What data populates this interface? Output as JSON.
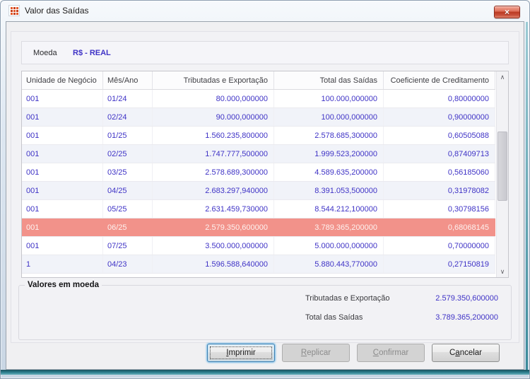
{
  "window": {
    "title": "Valor das Saídas"
  },
  "icons": {
    "close": "×",
    "scroll_up": "∧",
    "scroll_down": "∨"
  },
  "moeda": {
    "label": "Moeda",
    "value": "R$ - REAL"
  },
  "table": {
    "columns": [
      {
        "label": "Unidade de Negócio",
        "align": "left"
      },
      {
        "label": "Mês/Ano",
        "align": "left"
      },
      {
        "label": "Tributadas e Exportação",
        "align": "right"
      },
      {
        "label": "Total das Saídas",
        "align": "right"
      },
      {
        "label": "Coeficiente de Creditamento",
        "align": "right"
      }
    ],
    "selected_index": 7,
    "rows": [
      [
        "001",
        "01/24",
        "80.000,000000",
        "100.000,000000",
        "0,80000000"
      ],
      [
        "001",
        "02/24",
        "90.000,000000",
        "100.000,000000",
        "0,90000000"
      ],
      [
        "001",
        "01/25",
        "1.560.235,800000",
        "2.578.685,300000",
        "0,60505088"
      ],
      [
        "001",
        "02/25",
        "1.747.777,500000",
        "1.999.523,200000",
        "0,87409713"
      ],
      [
        "001",
        "03/25",
        "2.578.689,300000",
        "4.589.635,200000",
        "0,56185060"
      ],
      [
        "001",
        "04/25",
        "2.683.297,940000",
        "8.391.053,500000",
        "0,31978082"
      ],
      [
        "001",
        "05/25",
        "2.631.459,730000",
        "8.544.212,100000",
        "0,30798156"
      ],
      [
        "001",
        "06/25",
        "2.579.350,600000",
        "3.789.365,200000",
        "0,68068145"
      ],
      [
        "001",
        "07/25",
        "3.500.000,000000",
        "5.000.000,000000",
        "0,70000000"
      ],
      [
        "1",
        "04/23",
        "1.596.588,640000",
        "5.880.443,770000",
        "0,27150819"
      ]
    ]
  },
  "summary": {
    "legend": "Valores em moeda",
    "items": [
      {
        "label": "Tributadas e Exportação",
        "value": "2.579.350,600000"
      },
      {
        "label": "Total das Saídas",
        "value": "3.789.365,200000"
      }
    ]
  },
  "buttons": [
    {
      "name": "imprimir",
      "pre": "",
      "key": "I",
      "post": "mprimir",
      "enabled": true,
      "default": true
    },
    {
      "name": "replicar",
      "pre": "",
      "key": "R",
      "post": "eplicar",
      "enabled": false,
      "default": false
    },
    {
      "name": "confirmar",
      "pre": "",
      "key": "C",
      "post": "onfirmar",
      "enabled": false,
      "default": false
    },
    {
      "name": "cancelar",
      "pre": "C",
      "key": "a",
      "post": "ncelar",
      "enabled": true,
      "default": false
    }
  ],
  "colors": {
    "data_text": "#3F33C6",
    "selected_bg": "#F2928A",
    "selected_text": "#FDF2F0",
    "accent_border": "#3C7FB1"
  }
}
